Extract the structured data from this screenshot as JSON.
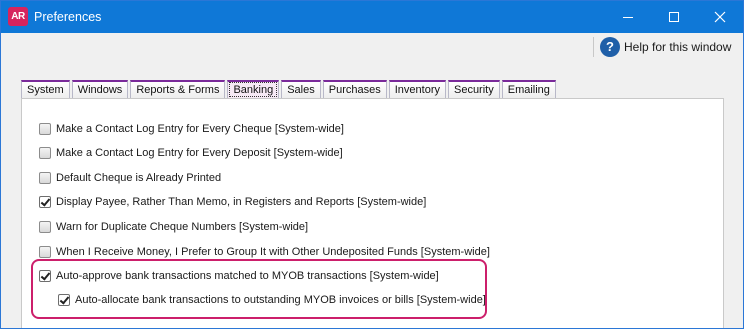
{
  "window": {
    "title": "Preferences",
    "app_icon_text": "AR",
    "controls": [
      "minimize-icon",
      "maximize-icon",
      "close-icon"
    ]
  },
  "help": {
    "label": "Help for this window",
    "icon": "?"
  },
  "tabs": [
    {
      "label": "System",
      "active": false
    },
    {
      "label": "Windows",
      "active": false
    },
    {
      "label": "Reports & Forms",
      "active": false
    },
    {
      "label": "Banking",
      "active": true
    },
    {
      "label": "Sales",
      "active": false
    },
    {
      "label": "Purchases",
      "active": false
    },
    {
      "label": "Inventory",
      "active": false
    },
    {
      "label": "Security",
      "active": false
    },
    {
      "label": "Emailing",
      "active": false
    }
  ],
  "options": [
    {
      "label": "Make a Contact Log Entry for Every Cheque [System-wide]",
      "checked": false
    },
    {
      "label": "Make a Contact Log Entry for Every Deposit [System-wide]",
      "checked": false
    },
    {
      "label": "Default Cheque is Already Printed",
      "checked": false
    },
    {
      "label": "Display Payee, Rather Than Memo, in Registers and Reports [System-wide]",
      "checked": true
    },
    {
      "label": "Warn for Duplicate Cheque Numbers [System-wide]",
      "checked": false
    },
    {
      "label": "When I Receive Money, I Prefer to Group It with Other Undeposited Funds [System-wide]",
      "checked": false
    },
    {
      "label": "Auto-approve bank transactions matched to MYOB transactions [System-wide]",
      "checked": true
    },
    {
      "label": "Auto-allocate bank transactions to outstanding MYOB invoices or bills [System-wide]",
      "checked": true
    }
  ],
  "colors": {
    "titlebar": "#0f78d7",
    "highlight": "#cc1f6b",
    "app_icon": "#d6245e"
  }
}
